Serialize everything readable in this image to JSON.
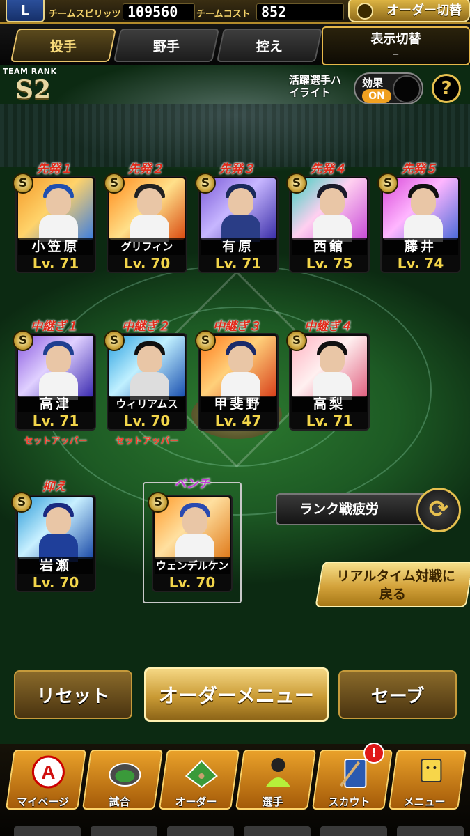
{
  "header": {
    "team_logo": "L",
    "team_spirits_label": "チームスピリッツ",
    "team_spirits_value": "109560",
    "team_cost_label": "チームコスト",
    "team_cost_value": "852",
    "order_switch_label": "オーダー切替"
  },
  "tabs": [
    {
      "label": "投手",
      "active": true
    },
    {
      "label": "野手",
      "active": false
    },
    {
      "label": "控え",
      "active": false
    }
  ],
  "display_toggle": {
    "title": "表示切替",
    "value": "–"
  },
  "team_rank": {
    "label": "TEAM RANK",
    "value": "S2"
  },
  "highlight": {
    "label": "活躍選手ハイライト",
    "effect_label": "効果",
    "effect_state": "ON"
  },
  "help_label": "?",
  "starters": [
    {
      "position": "先発１",
      "name": "小笠原",
      "level": "Lv. 71",
      "badge": "S"
    },
    {
      "position": "先発２",
      "name": "グリフィン",
      "level": "Lv. 70",
      "badge": "S"
    },
    {
      "position": "先発３",
      "name": "有原",
      "level": "Lv. 71",
      "badge": "S"
    },
    {
      "position": "先発４",
      "name": "西舘",
      "level": "Lv. 75",
      "badge": "S"
    },
    {
      "position": "先発５",
      "name": "藤井",
      "level": "Lv. 74",
      "badge": "S"
    }
  ],
  "relievers": [
    {
      "position": "中継ぎ１",
      "name": "高津",
      "level": "Lv. 71",
      "badge": "S",
      "role": "セットアッパー"
    },
    {
      "position": "中継ぎ２",
      "name": "ウィリアムス",
      "level": "Lv. 70",
      "badge": "S",
      "role": "セットアッパー"
    },
    {
      "position": "中継ぎ３",
      "name": "甲斐野",
      "level": "Lv. 47",
      "badge": "S",
      "role": ""
    },
    {
      "position": "中継ぎ４",
      "name": "高梨",
      "level": "Lv. 71",
      "badge": "S",
      "role": ""
    }
  ],
  "closer": {
    "position": "抑え",
    "name": "岩瀬",
    "level": "Lv. 70",
    "badge": "S"
  },
  "bench": {
    "position": "ベンチ",
    "name": "ウェンデルケン",
    "level": "Lv. 70",
    "badge": "S"
  },
  "rank_fatigue_label": "ランク戦疲労",
  "return_button": {
    "line1": "リアルタイム対戦に",
    "line2": "戻る"
  },
  "actions": {
    "reset": "リセット",
    "order_menu": "オーダーメニュー",
    "save": "セーブ"
  },
  "nav": [
    {
      "label": "マイページ",
      "icon": "mypage-icon"
    },
    {
      "label": "試合",
      "icon": "stadium-icon"
    },
    {
      "label": "オーダー",
      "icon": "order-icon"
    },
    {
      "label": "選手",
      "icon": "player-icon"
    },
    {
      "label": "スカウト",
      "icon": "scout-icon"
    },
    {
      "label": "メニュー",
      "icon": "menu-icon"
    }
  ],
  "notification_badge": "!",
  "colors": {
    "accent_gold": "#e6c04f",
    "position_red": "#e22a1a",
    "level_yellow": "#f2d54a"
  }
}
